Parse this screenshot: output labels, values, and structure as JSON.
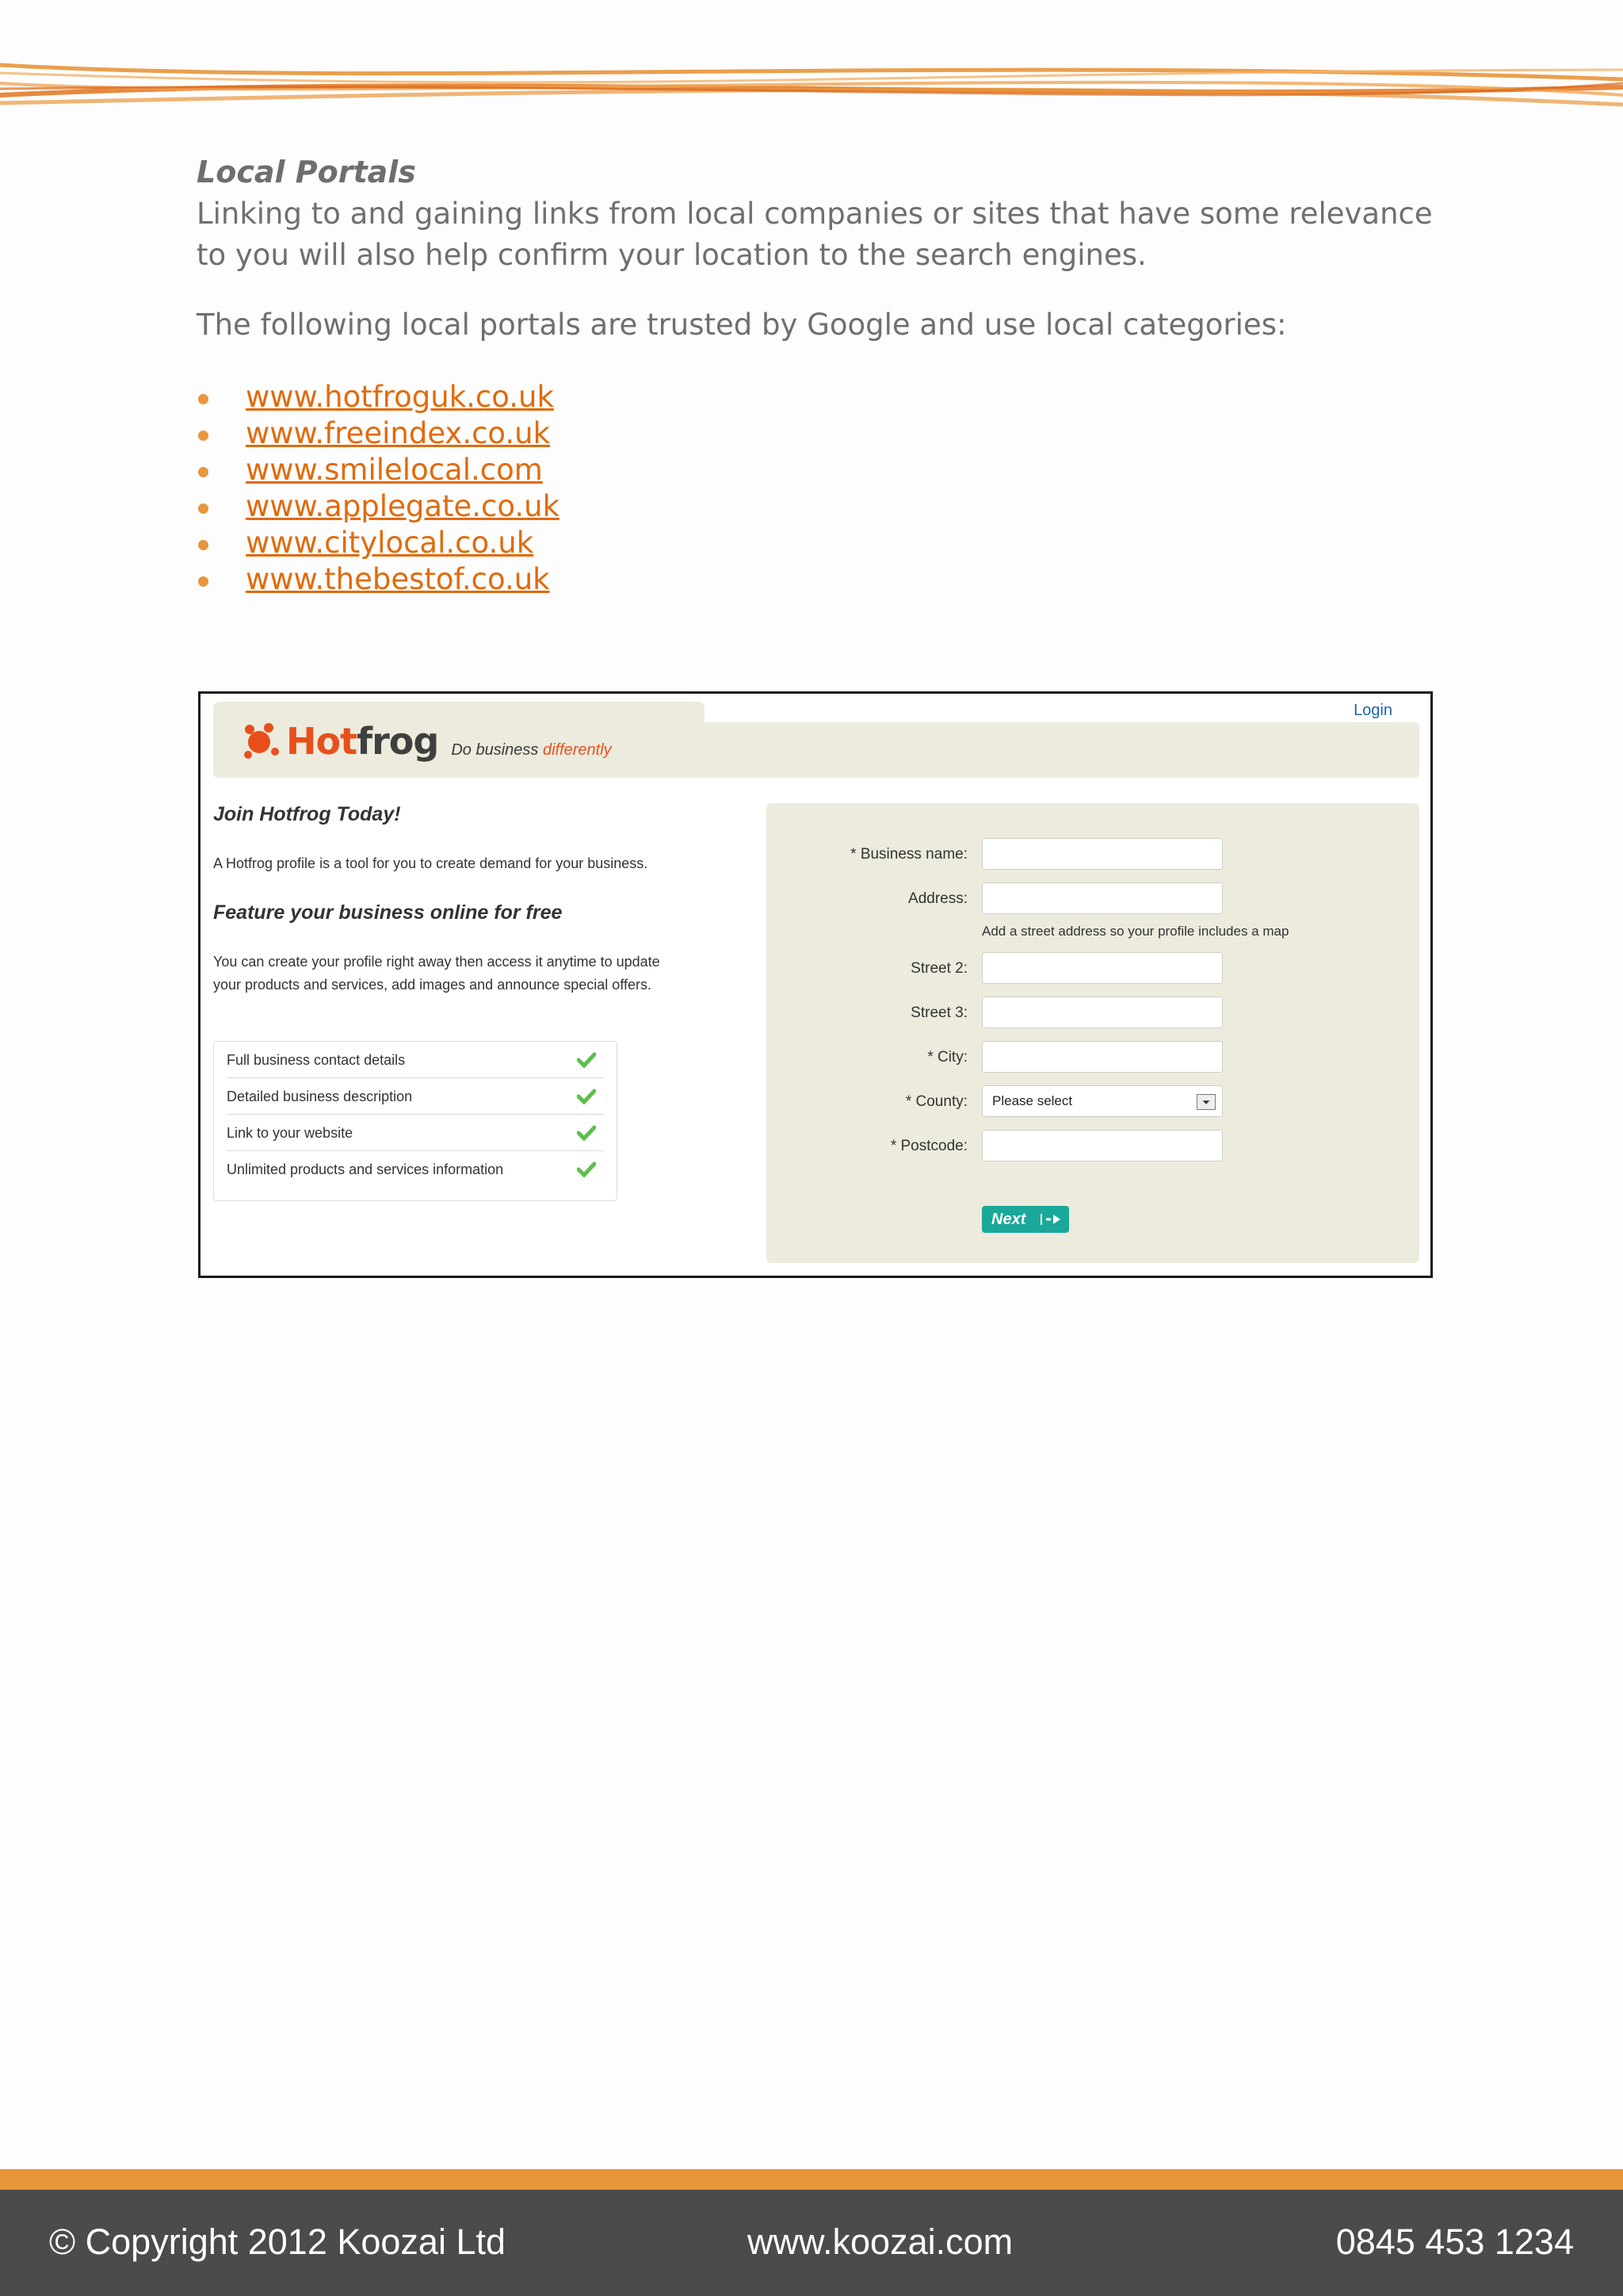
{
  "section": {
    "title": "Local Portals",
    "paragraph1": "Linking to and gaining links from local companies or sites that have some relevance to you will also help confirm your location to the search engines.",
    "paragraph2": "The following local portals are trusted by Google and use local categories:"
  },
  "portals": [
    "www.hotfroguk.co.uk",
    "www.freeindex.co.uk",
    "www.smilelocal.com",
    "www.applegate.co.uk",
    "www.citylocal.co.uk",
    "www.thebestof.co.uk"
  ],
  "hotfrog": {
    "brand_hot": "Hot",
    "brand_frog": "frog",
    "tagline": "Do business",
    "tagline_accent": "differently",
    "login": "Login",
    "join_title": "Join Hotfrog Today!",
    "description": "A Hotfrog profile is a tool for you to create demand for your business.",
    "feature_title": "Feature your business online for free",
    "body": "You can create your profile right away then access it anytime to update your products and services, add images and announce special offers.",
    "features": [
      "Full business contact details",
      "Detailed business description",
      "Link to your website",
      "Unlimited products and services information"
    ],
    "form": {
      "business_name_label": "* Business name:",
      "address_label": "Address:",
      "address_hint": "Add a street address so your profile includes a map",
      "street2_label": "Street 2:",
      "street3_label": "Street 3:",
      "city_label": "* City:",
      "county_label": "* County:",
      "county_value": "Please select",
      "postcode_label": "* Postcode:",
      "next_label": "Next"
    },
    "colors": {
      "brand_orange": "#e8501b",
      "panel": "#ecebdd",
      "check": "#5cbf4a",
      "next": "#1aa89a"
    }
  },
  "footer": {
    "copyright": "© Copyright 2012 Koozai Ltd",
    "website": "www.koozai.com",
    "phone": "0845 453 1234"
  },
  "colors": {
    "accent_orange": "#e8953a",
    "link": "#e06b0c",
    "footer_bg": "#4b4b4b"
  }
}
